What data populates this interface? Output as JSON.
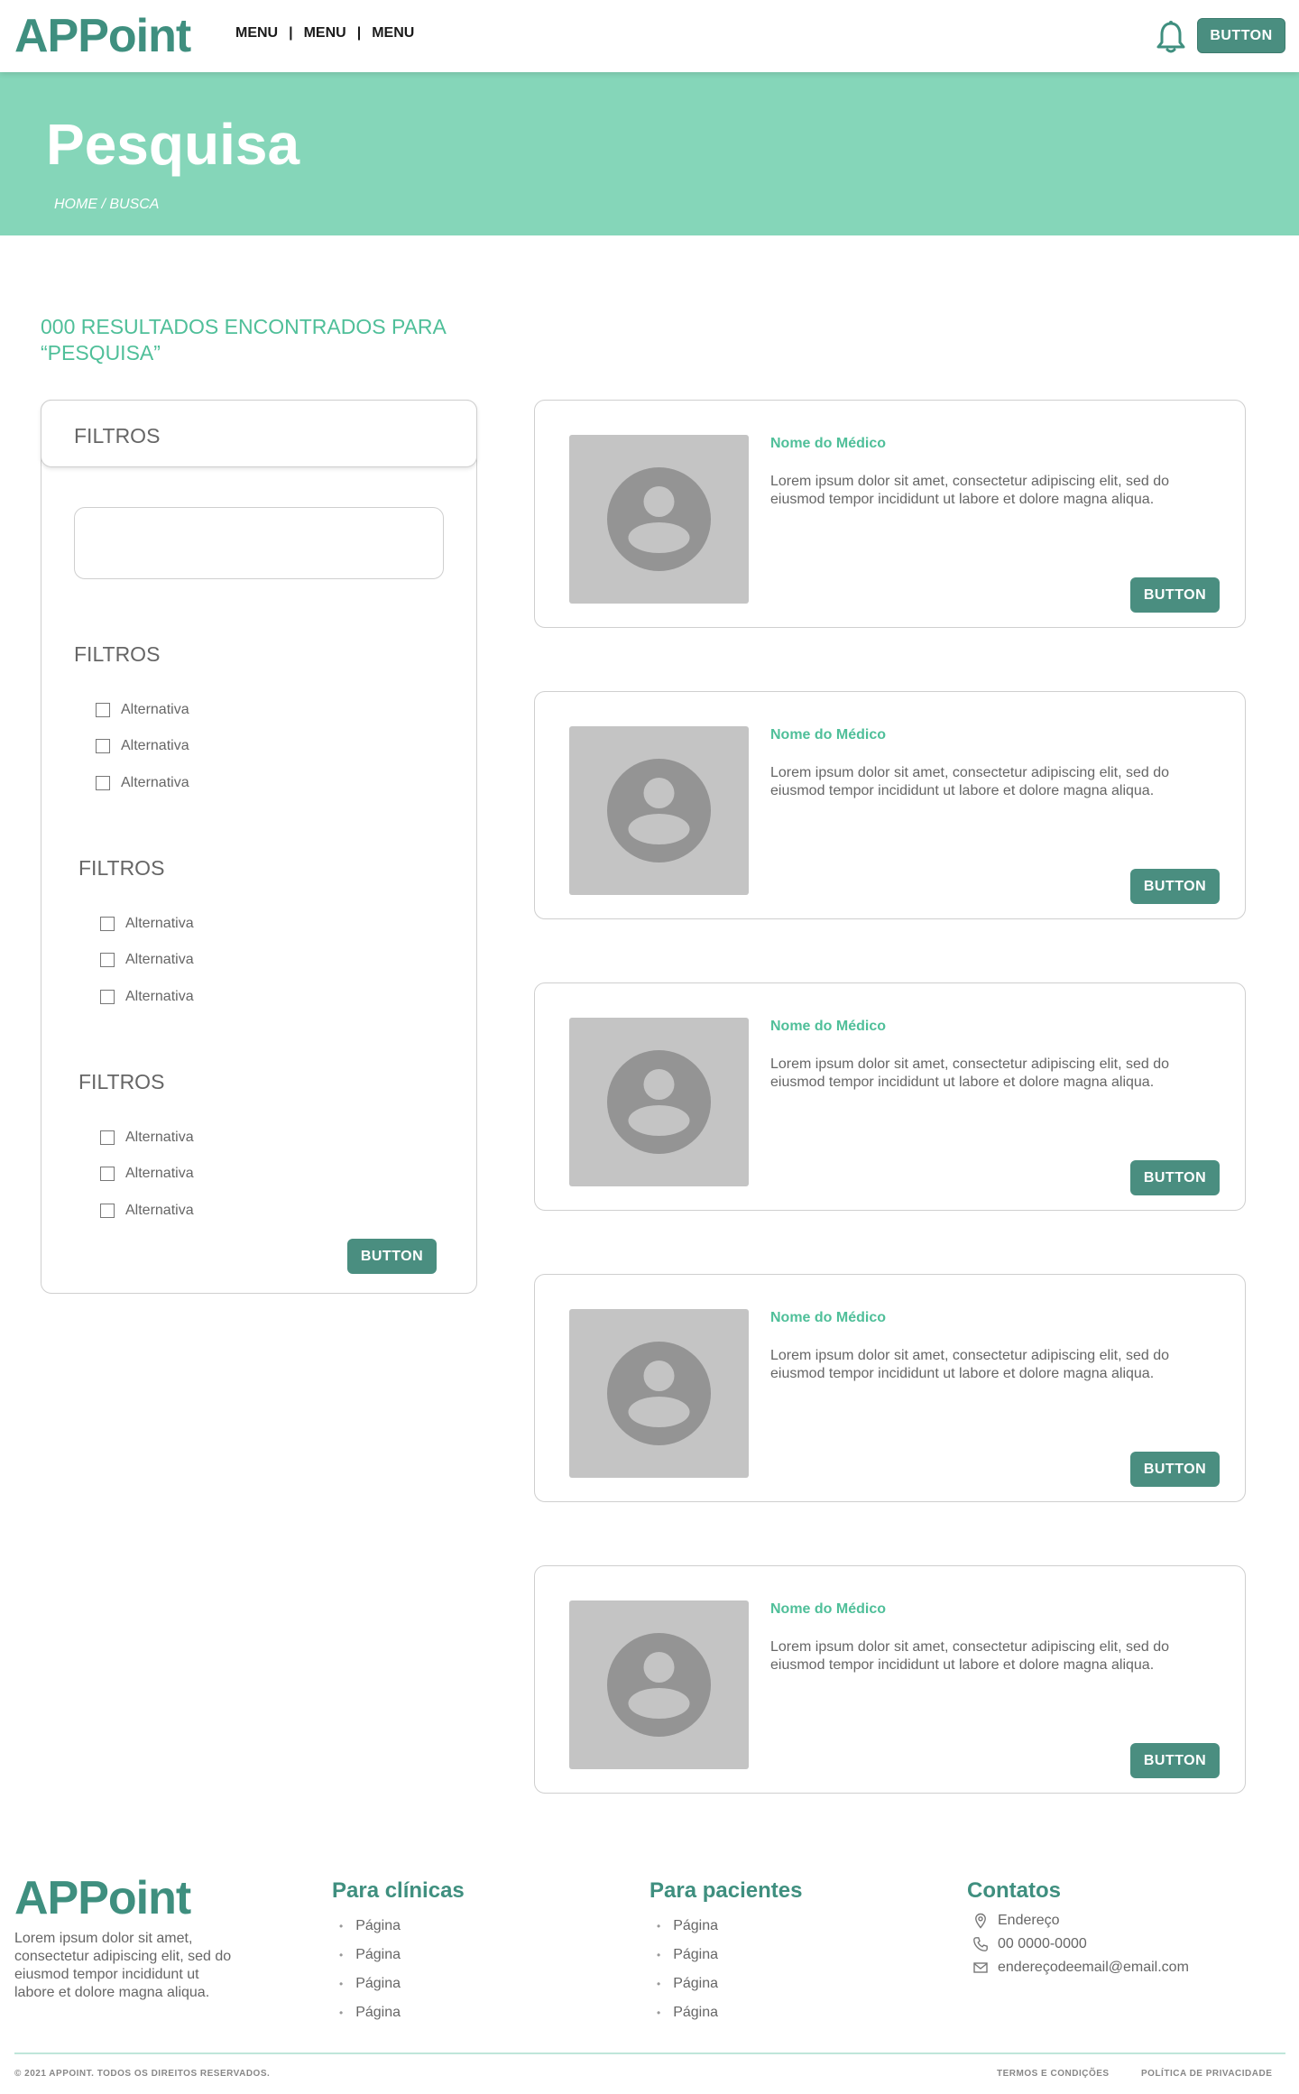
{
  "header": {
    "logo": "APPoint",
    "menu": [
      "MENU",
      "MENU",
      "MENU"
    ],
    "separator": "|",
    "notification_icon": "bell-icon",
    "button_label": "BUTTON"
  },
  "hero": {
    "title": "Pesquisa",
    "breadcrumb": "HOME / BUSCA",
    "background_color": "#85d6b9"
  },
  "results": {
    "heading": "000 RESULTADOS ENCONTRADOS PARA “PESQUISA”"
  },
  "filters": {
    "panel_title": "FILTROS",
    "search_value": "",
    "groups": [
      {
        "title": "FILTROS",
        "options": [
          "Alternativa",
          "Alternativa",
          "Alternativa"
        ]
      },
      {
        "title": "FILTROS",
        "options": [
          "Alternativa",
          "Alternativa",
          "Alternativa"
        ]
      },
      {
        "title": "FILTROS",
        "options": [
          "Alternativa",
          "Alternativa",
          "Alternativa"
        ]
      }
    ],
    "button_label": "BUTTON"
  },
  "cards": [
    {
      "name": "Nome do Médico",
      "description": "Lorem ipsum dolor sit amet, consectetur adipiscing elit, sed do eiusmod tempor incididunt ut labore et dolore magna aliqua.",
      "button_label": "BUTTON",
      "photo_icon": "user-avatar-icon"
    },
    {
      "name": "Nome do Médico",
      "description": "Lorem ipsum dolor sit amet, consectetur adipiscing elit, sed do eiusmod tempor incididunt ut labore et dolore magna aliqua.",
      "button_label": "BUTTON",
      "photo_icon": "user-avatar-icon"
    },
    {
      "name": "Nome do Médico",
      "description": "Lorem ipsum dolor sit amet, consectetur adipiscing elit, sed do eiusmod tempor incididunt ut labore et dolore magna aliqua.",
      "button_label": "BUTTON",
      "photo_icon": "user-avatar-icon"
    },
    {
      "name": "Nome do Médico",
      "description": "Lorem ipsum dolor sit amet, consectetur adipiscing elit, sed do eiusmod tempor incididunt ut labore et dolore magna aliqua.",
      "button_label": "BUTTON",
      "photo_icon": "user-avatar-icon"
    },
    {
      "name": "Nome do Médico",
      "description": "Lorem ipsum dolor sit amet, consectetur adipiscing elit, sed do eiusmod tempor incididunt ut labore et dolore magna aliqua.",
      "button_label": "BUTTON",
      "photo_icon": "user-avatar-icon"
    }
  ],
  "footer": {
    "logo": "APPoint",
    "about": "Lorem ipsum dolor sit amet, consectetur adipiscing elit, sed do eiusmod tempor incididunt ut labore et dolore magna aliqua.",
    "clinics": {
      "title": "Para clínicas",
      "links": [
        "Página",
        "Página",
        "Página",
        "Página"
      ]
    },
    "patients": {
      "title": "Para pacientes",
      "links": [
        "Página",
        "Página",
        "Página",
        "Página"
      ]
    },
    "contacts": {
      "title": "Contatos",
      "address": "Endereço",
      "phone": "00 0000-0000",
      "email": "endereçodeemail@email.com",
      "icons": [
        "map-pin-icon",
        "phone-icon",
        "mail-icon"
      ]
    },
    "copyright": "© 2021 APPOINT. TODOS OS DIREITOS RESERVADOS.",
    "terms": "TERMOS E CONDIÇÕES",
    "privacy": "POLÍTICA DE PRIVACIDADE"
  },
  "colors": {
    "brand_dark": "#3f8f7f",
    "brand_accent": "#4fbf99",
    "button": "#4a8e80",
    "hero": "#85d6b9",
    "photo_placeholder": "#c4c4c4"
  }
}
